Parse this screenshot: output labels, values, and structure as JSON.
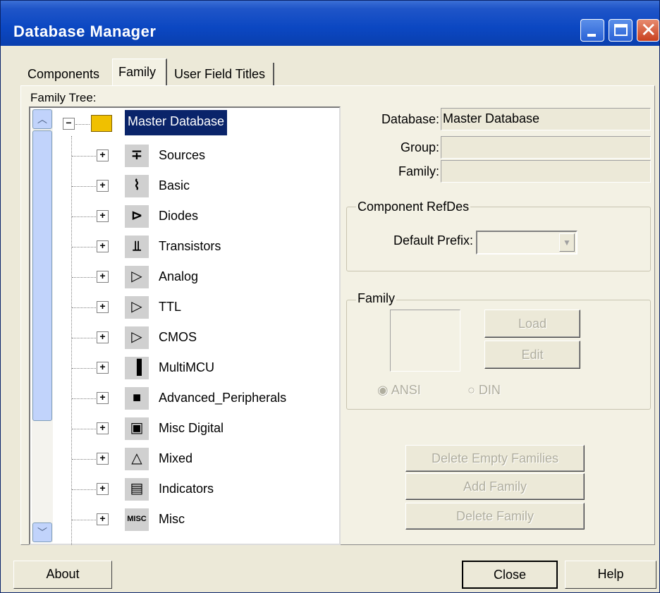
{
  "window": {
    "title": "Database Manager"
  },
  "tabs": [
    {
      "label": "Components"
    },
    {
      "label": "Family"
    },
    {
      "label": "User Field Titles"
    }
  ],
  "tree": {
    "label": "Family Tree:",
    "root": {
      "label": "Master Database",
      "expanded": true,
      "selected": true
    },
    "items": [
      {
        "label": "Sources",
        "icon": "sources-icon",
        "glyph": "∓"
      },
      {
        "label": "Basic",
        "icon": "basic-icon",
        "glyph": "⌇"
      },
      {
        "label": "Diodes",
        "icon": "diodes-icon",
        "glyph": "⊳"
      },
      {
        "label": "Transistors",
        "icon": "transistors-icon",
        "glyph": "⫫"
      },
      {
        "label": "Analog",
        "icon": "analog-icon",
        "glyph": "▷"
      },
      {
        "label": "TTL",
        "icon": "ttl-icon",
        "glyph": "▷"
      },
      {
        "label": "CMOS",
        "icon": "cmos-icon",
        "glyph": "▷"
      },
      {
        "label": "MultiMCU",
        "icon": "multimcu-icon",
        "glyph": "▐"
      },
      {
        "label": "Advanced_Peripherals",
        "icon": "advanced-peripherals-icon",
        "glyph": "■"
      },
      {
        "label": "Misc Digital",
        "icon": "misc-digital-icon",
        "glyph": "▣"
      },
      {
        "label": "Mixed",
        "icon": "mixed-icon",
        "glyph": "△"
      },
      {
        "label": "Indicators",
        "icon": "indicators-icon",
        "glyph": "▤"
      },
      {
        "label": "Misc",
        "icon": "misc-icon",
        "glyph": "MISC"
      }
    ]
  },
  "details": {
    "database_label": "Database:",
    "database_value": "Master Database",
    "group_label": "Group:",
    "group_value": "",
    "family_label": "Family:",
    "family_value": ""
  },
  "refdes": {
    "title": "Component RefDes",
    "prefix_label": "Default Prefix:",
    "prefix_value": ""
  },
  "family_group": {
    "title": "Family",
    "load_label": "Load",
    "edit_label": "Edit",
    "ansi_label": "ANSI",
    "din_label": "DIN"
  },
  "actions": {
    "delete_empty_label": "Delete Empty Families",
    "add_family_label": "Add Family",
    "delete_family_label": "Delete Family"
  },
  "footer": {
    "about_label": "About",
    "close_label": "Close",
    "help_label": "Help"
  },
  "colors": {
    "title_bar": "#0b47c2",
    "selection": "#0a246a",
    "dialog_bg": "#ece9d8"
  }
}
